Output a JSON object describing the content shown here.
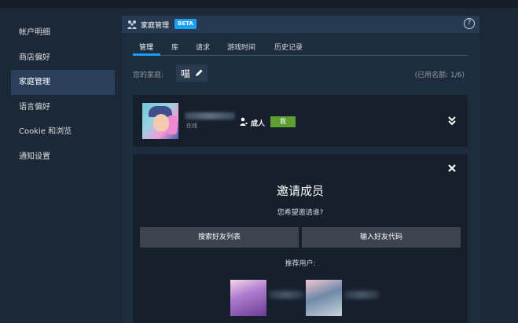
{
  "sidebar": {
    "items": [
      {
        "label": "帐户明细",
        "active": false
      },
      {
        "label": "商店偏好",
        "active": false
      },
      {
        "label": "家庭管理",
        "active": true
      },
      {
        "label": "语言偏好",
        "active": false
      },
      {
        "label": "Cookie 和浏览",
        "active": false
      },
      {
        "label": "通知设置",
        "active": false
      }
    ]
  },
  "header": {
    "title": "家庭管理",
    "badge": "BETA",
    "help_glyph": "?"
  },
  "tabs": [
    {
      "label": "管理",
      "active": true
    },
    {
      "label": "库",
      "active": false
    },
    {
      "label": "请求",
      "active": false
    },
    {
      "label": "游戏时间",
      "active": false
    },
    {
      "label": "历史记录",
      "active": false
    }
  ],
  "family": {
    "label": "您的家庭:",
    "name": "喵",
    "member_count": "(已用名额: 1/6)"
  },
  "member": {
    "status": "在线",
    "role": "成人",
    "me_badge": "我"
  },
  "invite": {
    "title": "邀请成员",
    "subtitle": "您希望邀请谁?",
    "search_button": "搜索好友列表",
    "code_button": "输入好友代码",
    "recommend_label": "推荐用户:"
  },
  "colors": {
    "background": "#1b2838",
    "accent": "#1a9fff",
    "me_badge": "#5c9e32",
    "button": "#3d4450"
  },
  "icons": {
    "header": "family-icon",
    "help": "help-icon",
    "edit": "pencil-icon",
    "role": "adult-person-icon",
    "expand": "double-chevron-down-icon",
    "close": "close-icon"
  }
}
